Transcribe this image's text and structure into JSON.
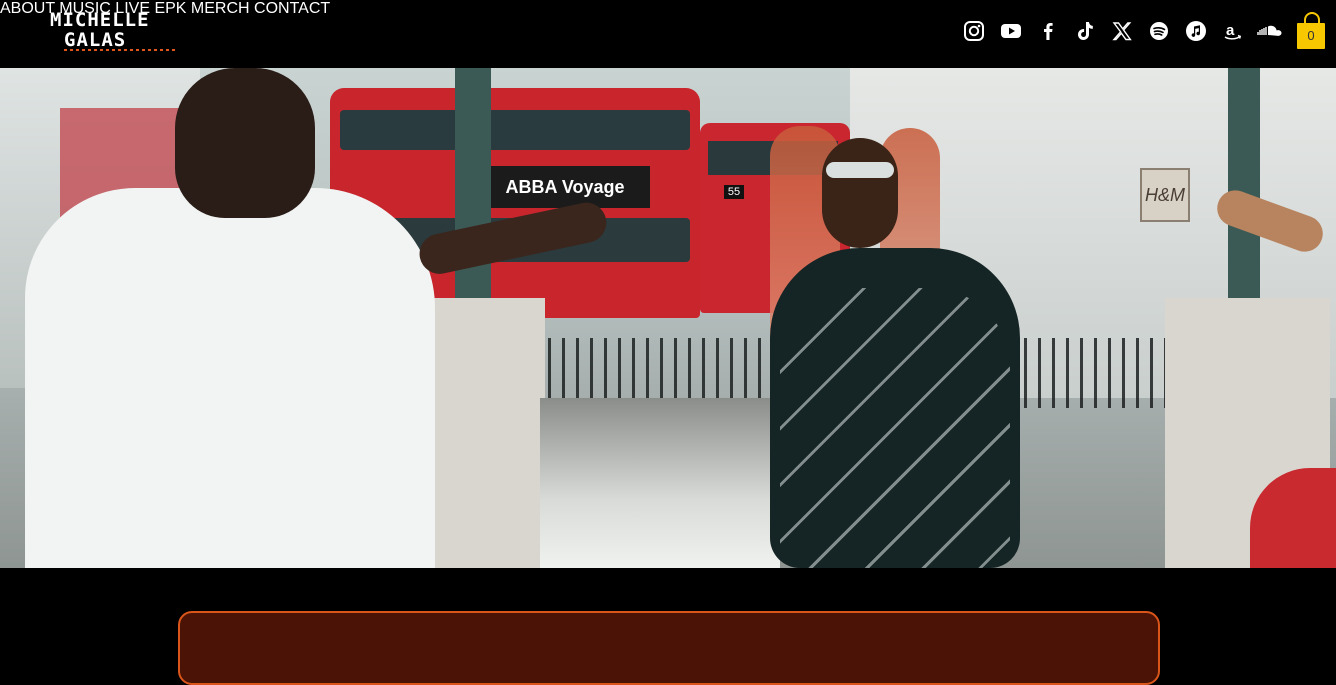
{
  "brand": {
    "logo_line1": "MICHELLE",
    "logo_line2": "GALAS",
    "accent_color": "#e0561c"
  },
  "nav": {
    "items": [
      {
        "label": "ABOUT"
      },
      {
        "label": "MUSIC"
      },
      {
        "label": "LIVE"
      },
      {
        "label": "EPK"
      },
      {
        "label": "MERCH"
      },
      {
        "label": "CONTACT"
      }
    ]
  },
  "social": {
    "icons": [
      "instagram-icon",
      "youtube-icon",
      "facebook-icon",
      "tiktok-icon",
      "x-icon",
      "spotify-icon",
      "apple-music-icon",
      "amazon-icon",
      "soundcloud-icon"
    ]
  },
  "cart": {
    "count": "0",
    "color": "#f7c800"
  },
  "hero": {
    "bus_ad_text": "ABBA Voyage",
    "bus_number": "55",
    "store_sign": "H&M"
  },
  "panel": {
    "background": "#4a1305",
    "border": "#d9551a"
  }
}
